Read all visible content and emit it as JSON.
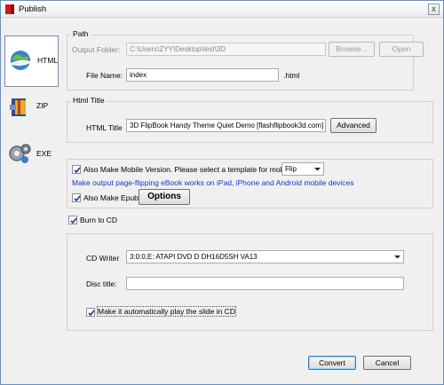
{
  "window": {
    "title": "Publish",
    "close": "x"
  },
  "sidebar": {
    "items": [
      {
        "label": "HTML",
        "icon": "html-globe-icon"
      },
      {
        "label": "ZIP",
        "icon": "zip-archive-icon"
      },
      {
        "label": "EXE",
        "icon": "exe-gear-icon"
      }
    ]
  },
  "path": {
    "legend": "Path",
    "output_folder_label": "Output Folder:",
    "output_folder_value": "C:\\Users\\ZYY\\Desktop\\test\\3D",
    "browse_label": "Browse...",
    "open_label": "Open",
    "file_name_label": "File Name:",
    "file_name_value": "index",
    "ext": ".html"
  },
  "html_title": {
    "legend": "Html Title",
    "label": "HTML Title",
    "value": "3D FlipBook Handy Theme Quiet Demo [flashflipbook3d.com]",
    "advanced_label": "Advanced"
  },
  "mobile": {
    "checkbox_label": "Also Make Mobile Version. Please select a template for mobile:",
    "template_value": "Flip",
    "note": "Make output page-flipping eBook works on iPad, iPhone and Android mobile devices",
    "epub_label": "Also Make Epub",
    "options_label": "Options"
  },
  "burn": {
    "checkbox_label": "Burn to CD",
    "cd_writer_label": "CD Writer",
    "cd_writer_value": "3:0:0,E: ATAPI   DVD D  DH16D5SH  VA13",
    "disc_title_label": "Disc title:",
    "disc_title_value": "",
    "autoplay_label": "Make it automatically play the  slide in CD"
  },
  "footer": {
    "convert_label": "Convert",
    "cancel_label": "Cancel"
  },
  "colors": {
    "accent_blue": "#1a35c8",
    "window_bg": "#f0f0f0"
  }
}
